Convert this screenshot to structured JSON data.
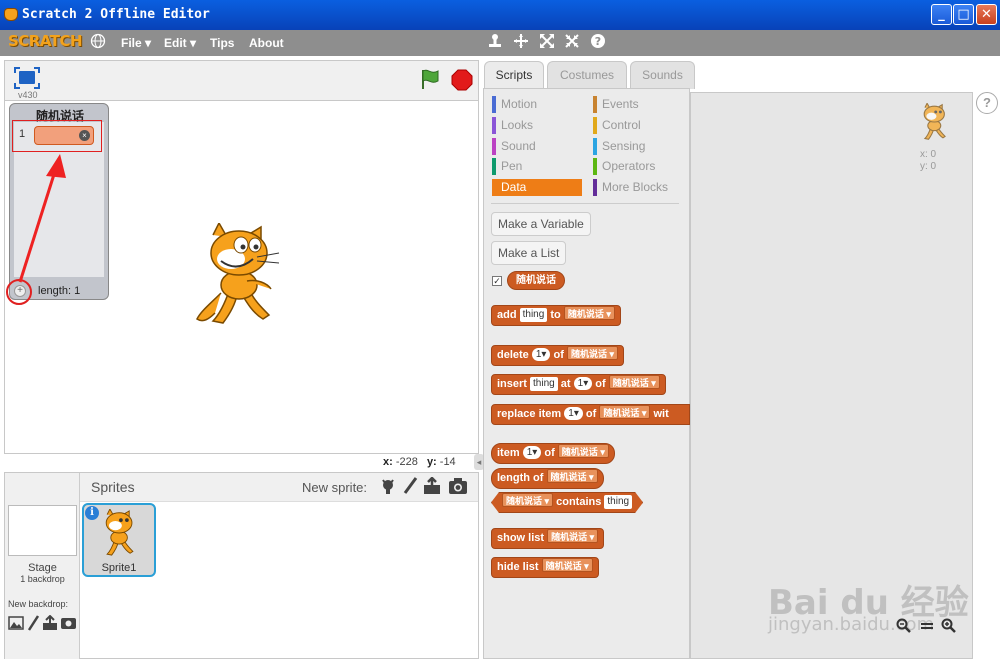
{
  "window": {
    "title": "Scratch 2 Offline Editor",
    "min": "_",
    "max": "□",
    "close": "✕"
  },
  "menu": {
    "logo": "SCRATCH",
    "file": "File ▾",
    "edit": "Edit ▾",
    "tips": "Tips",
    "about": "About"
  },
  "stage": {
    "version": "v430",
    "coords": {
      "x_label": "x:",
      "x": "-228",
      "y_label": "y:",
      "y": "-14"
    }
  },
  "list_monitor": {
    "title": "随机说话",
    "index": "1",
    "length": "length: 1"
  },
  "sprites": {
    "header": "Sprites",
    "new_sprite": "New sprite:",
    "stage_label": "Stage",
    "backdrops": "1 backdrop",
    "new_backdrop": "New backdrop:",
    "sprite1": "Sprite1"
  },
  "tabs": {
    "scripts": "Scripts",
    "costumes": "Costumes",
    "sounds": "Sounds"
  },
  "categories": {
    "motion": "Motion",
    "looks": "Looks",
    "sound": "Sound",
    "pen": "Pen",
    "data": "Data",
    "events": "Events",
    "control": "Control",
    "sensing": "Sensing",
    "operators": "Operators",
    "more": "More Blocks"
  },
  "buttons": {
    "make_variable": "Make a Variable",
    "make_list": "Make a List"
  },
  "list_name": "随机说话",
  "blocks": {
    "add": "add",
    "thing": "thing",
    "to": "to",
    "delete": "delete",
    "one": "1",
    "of": "of",
    "insert": "insert",
    "at": "at",
    "replace": "replace item",
    "with": "wit",
    "item": "item",
    "length": "length of",
    "contains": "contains",
    "show": "show list",
    "hide": "hide list"
  },
  "script_area": {
    "x": "x: 0",
    "y": "y: 0"
  },
  "watermark": {
    "main": "Bai du 经验",
    "sub": "jingyan.baidu.com"
  },
  "colors": {
    "data": "#ee7d16",
    "list": "#cc5b22",
    "motion": "#4a6cd4",
    "looks": "#8a55d7",
    "sound": "#bb42c3",
    "pen": "#0e9a6c",
    "events": "#c88330",
    "control": "#e1a91a",
    "sensing": "#2ca5e2",
    "operators": "#5cb712",
    "more": "#632d99"
  }
}
